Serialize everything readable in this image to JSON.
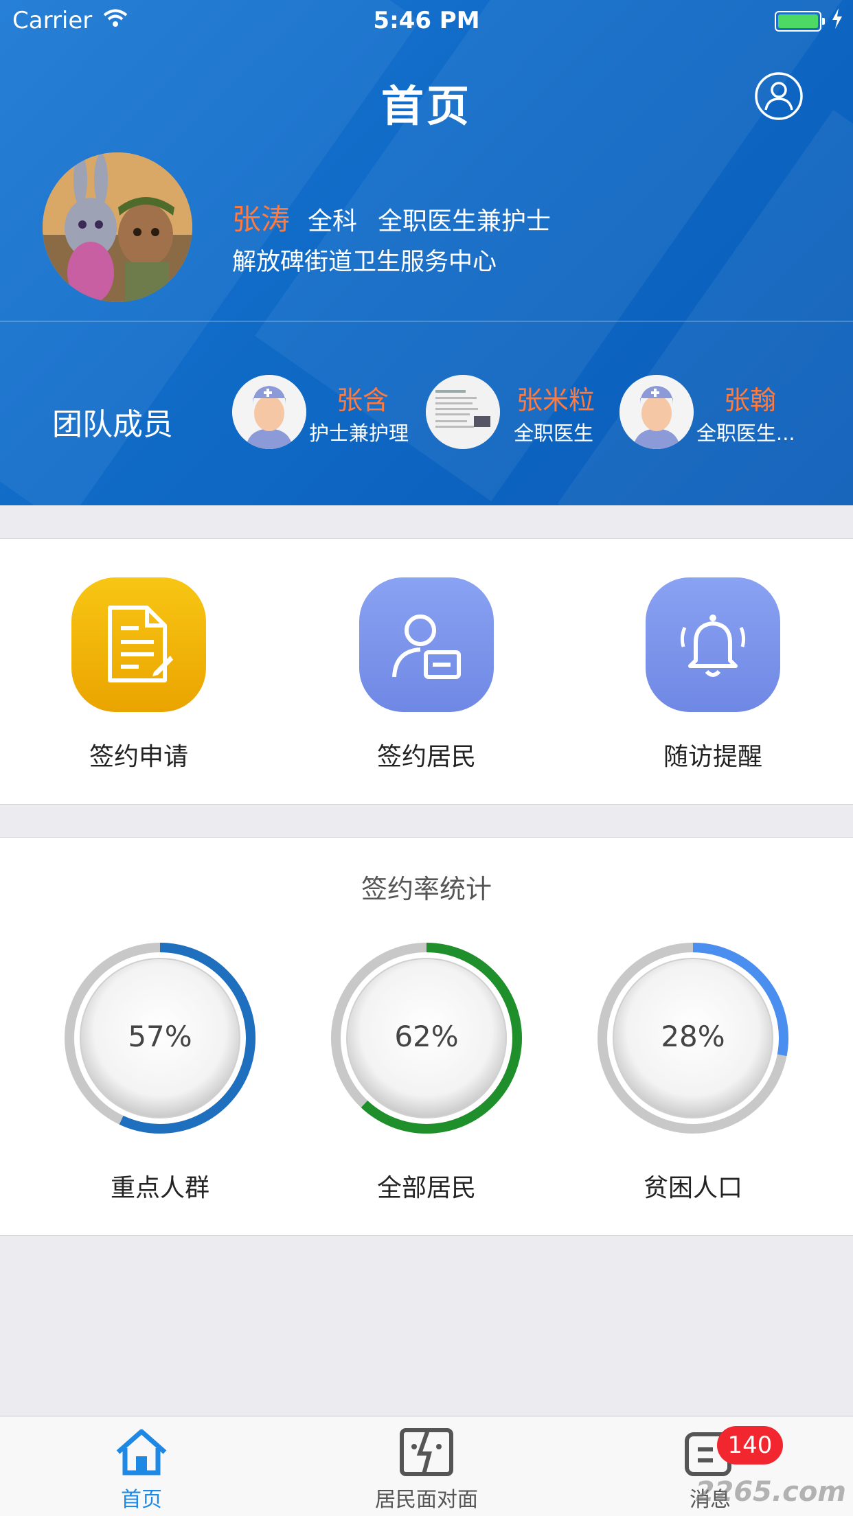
{
  "status_bar": {
    "carrier": "Carrier",
    "time": "5:46 PM"
  },
  "header": {
    "title": "首页",
    "doctor": {
      "name": "张涛",
      "department": "全科",
      "position": "全职医生兼护士",
      "organization": "解放碑街道卫生服务中心"
    },
    "team": {
      "label": "团队成员",
      "members": [
        {
          "name": "张含",
          "role": "护士兼护理"
        },
        {
          "name": "张米粒",
          "role": "全职医生"
        },
        {
          "name": "张翰",
          "role": "全职医生..."
        }
      ]
    }
  },
  "actions": [
    {
      "label": "签约申请",
      "icon": "document-icon",
      "color": "#f5b400"
    },
    {
      "label": "签约居民",
      "icon": "resident-card-icon",
      "color": "#7b94ec"
    },
    {
      "label": "随访提醒",
      "icon": "bell-icon",
      "color": "#7b94ec"
    }
  ],
  "stats": {
    "title": "签约率统计",
    "items": [
      {
        "label": "重点人群",
        "value_text": "57%",
        "value": 0.57,
        "color": "#1f6fbf"
      },
      {
        "label": "全部居民",
        "value_text": "62%",
        "value": 0.62,
        "color": "#1e8f2a"
      },
      {
        "label": "贫困人口",
        "value_text": "28%",
        "value": 0.28,
        "color": "#4a8ef0"
      }
    ]
  },
  "tabbar": {
    "tabs": [
      {
        "label": "首页",
        "icon": "home-icon",
        "active": true
      },
      {
        "label": "居民面对面",
        "icon": "face-to-face-icon",
        "active": false
      },
      {
        "label": "消息",
        "icon": "message-icon",
        "active": false,
        "badge": "140"
      }
    ]
  },
  "watermark": "2265.com"
}
